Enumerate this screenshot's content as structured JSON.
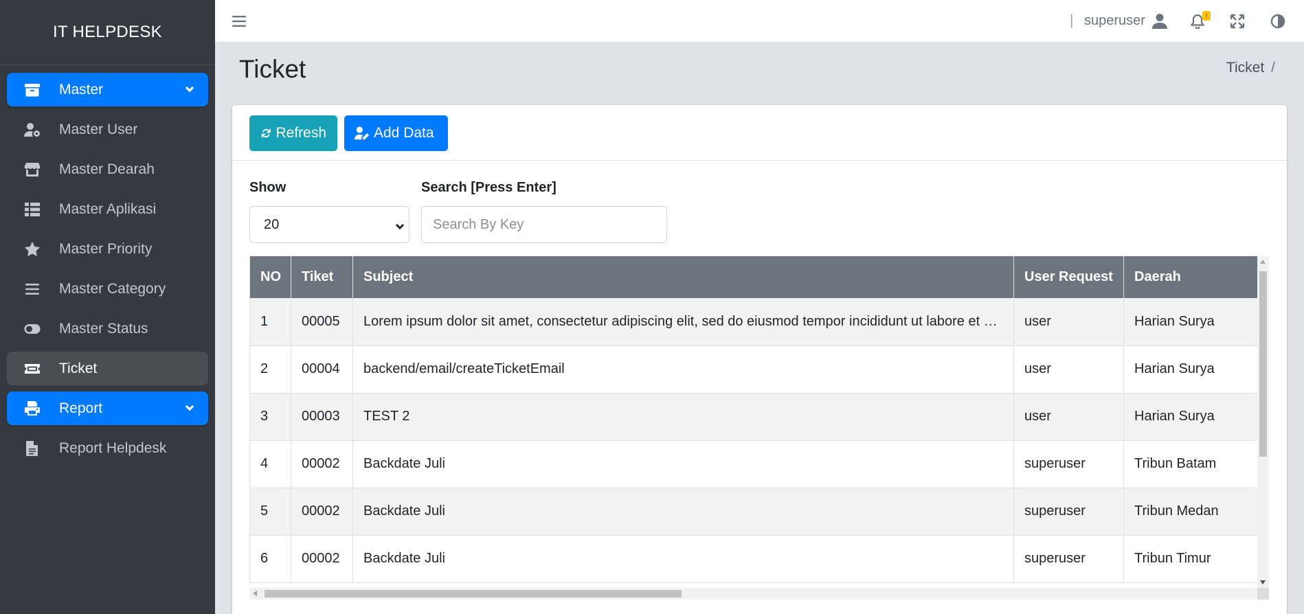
{
  "sidebar": {
    "brand": "IT HELPDESK",
    "items": [
      {
        "label": "Master",
        "icon": "archive-icon"
      },
      {
        "label": "Master User",
        "icon": "user-gear-icon"
      },
      {
        "label": "Master Dearah",
        "icon": "store-icon"
      },
      {
        "label": "Master Aplikasi",
        "icon": "table-list-icon"
      },
      {
        "label": "Master Priority",
        "icon": "star-icon"
      },
      {
        "label": "Master Category",
        "icon": "bars-icon"
      },
      {
        "label": "Master Status",
        "icon": "toggle-icon"
      },
      {
        "label": "Ticket",
        "icon": "ticket-icon"
      },
      {
        "label": "Report",
        "icon": "printer-icon"
      },
      {
        "label": "Report Helpdesk",
        "icon": "file-icon"
      }
    ]
  },
  "topbar": {
    "separator": "|",
    "username": "superuser",
    "badge": "!"
  },
  "header": {
    "title": "Ticket",
    "breadcrumb": "Ticket",
    "breadcrumb_sep": "/"
  },
  "toolbar": {
    "refresh_label": "Refresh",
    "add_label": "Add Data"
  },
  "filters": {
    "show_label": "Show",
    "show_value": "20",
    "search_label": "Search [Press Enter]",
    "search_placeholder": "Search By Key"
  },
  "table": {
    "columns": [
      "NO",
      "Tiket",
      "Subject",
      "User Request",
      "Daerah"
    ],
    "rows": [
      [
        "1",
        "00005",
        "Lorem ipsum dolor sit amet, consectetur adipiscing elit, sed do eiusmod tempor incididunt ut labore et dolore magna aliqua",
        "user",
        "Harian Surya"
      ],
      [
        "2",
        "00004",
        "backend/email/createTicketEmail",
        "user",
        "Harian Surya"
      ],
      [
        "3",
        "00003",
        "TEST 2",
        "user",
        "Harian Surya"
      ],
      [
        "4",
        "00002",
        "Backdate Juli",
        "superuser",
        "Tribun Batam"
      ],
      [
        "5",
        "00002",
        "Backdate Juli",
        "superuser",
        "Tribun Medan"
      ],
      [
        "6",
        "00002",
        "Backdate Juli",
        "superuser",
        "Tribun Timur"
      ]
    ]
  },
  "colors": {
    "sidebar_bg": "#343a40",
    "primary": "#007bff",
    "info": "#17a2b8",
    "table_header": "#6c757d"
  }
}
